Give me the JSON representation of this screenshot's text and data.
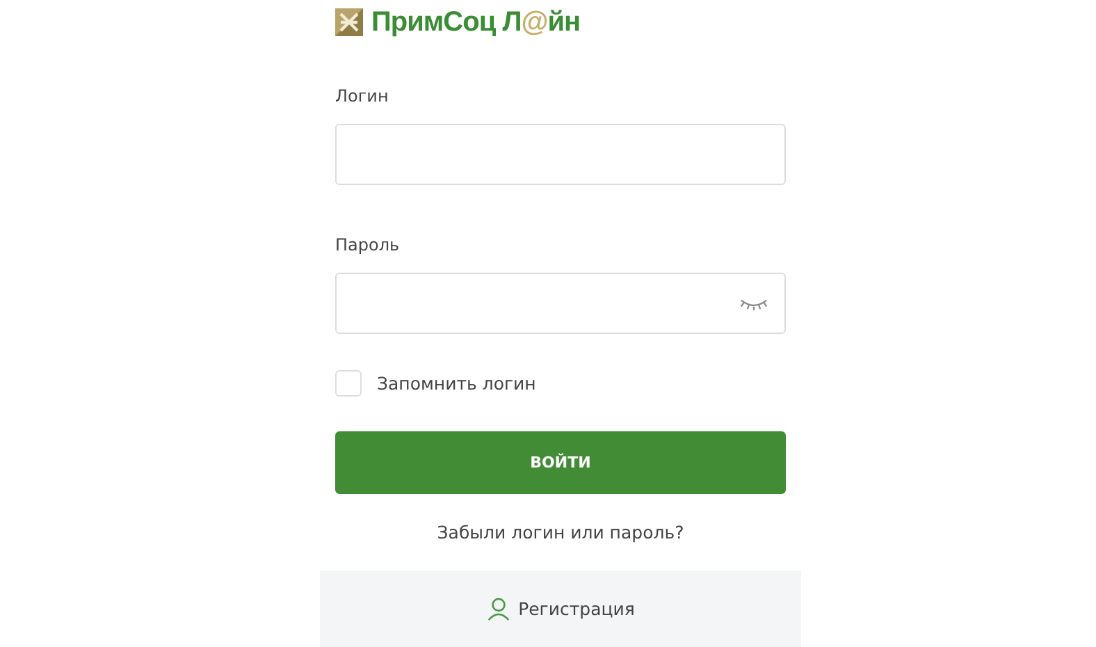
{
  "logo": {
    "parts": [
      {
        "text": "ПримСоц Л",
        "kind": "plain"
      },
      {
        "text": "@",
        "kind": "accent"
      },
      {
        "text": "йн",
        "kind": "plain"
      }
    ]
  },
  "fields": [
    {
      "label": "Логин",
      "kind": "text"
    },
    {
      "label": "Пароль",
      "kind": "password"
    }
  ],
  "remember": {
    "label": "Запомнить логин",
    "checked": false
  },
  "submit": "ВОЙТИ",
  "forgot": "Забыли логин или пароль?",
  "register": "Регистрация"
}
